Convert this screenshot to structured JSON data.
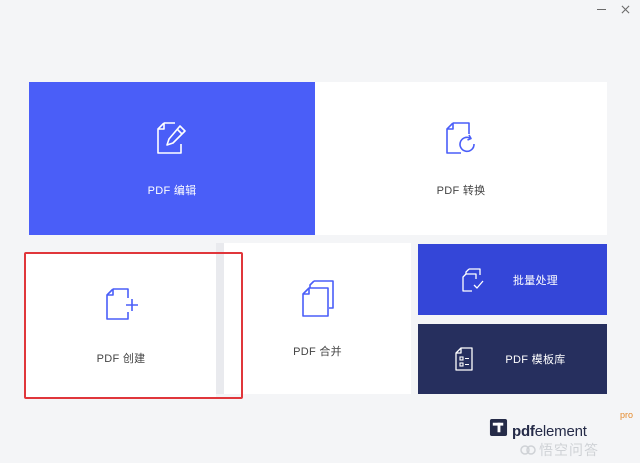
{
  "window": {
    "minimize_icon": "minimize-icon",
    "close_icon": "close-icon"
  },
  "tiles": {
    "edit": {
      "label": "PDF 编辑",
      "icon": "edit-document-icon",
      "color": "#4a5ef8"
    },
    "convert": {
      "label": "PDF 转换",
      "icon": "convert-document-icon",
      "color": "#ffffff"
    },
    "create": {
      "label": "PDF 创建",
      "icon": "create-document-icon",
      "color": "#ffffff",
      "selected": true
    },
    "merge": {
      "label": "PDF 合并",
      "icon": "merge-documents-icon",
      "color": "#ffffff"
    },
    "batch": {
      "label": "批量处理",
      "icon": "batch-process-icon",
      "color": "#3446d8"
    },
    "template": {
      "label": "PDF 模板库",
      "icon": "template-library-icon",
      "color": "#262f5e"
    }
  },
  "brand": {
    "name_bold": "pdf",
    "name_rest": "element",
    "suffix": "pro",
    "accent": "#e58a2c"
  },
  "watermark": {
    "text": "悟空问答"
  },
  "selection_color": "#e0363b"
}
